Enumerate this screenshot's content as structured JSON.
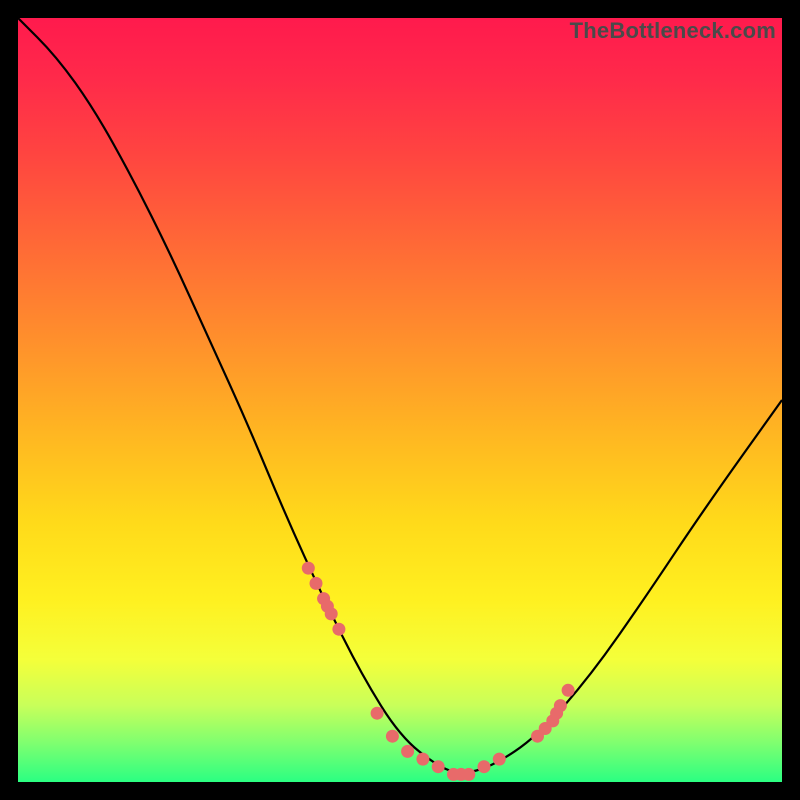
{
  "watermark": "TheBottleneck.com",
  "colors": {
    "frame": "#000000",
    "curve": "#000000",
    "dots": "#e86a6a",
    "gradient_top": "#ff1a4d",
    "gradient_bottom": "#2bff82"
  },
  "chart_data": {
    "type": "line",
    "title": "",
    "xlabel": "",
    "ylabel": "",
    "xlim": [
      0,
      100
    ],
    "ylim": [
      0,
      100
    ],
    "grid": false,
    "legend": false,
    "description": "V-shaped bottleneck curve; y decreases from ~100 at x=0 to ~0 near x≈55, then rises to ~50 at x=100. Salmon dots cluster on the curve between x≈38–72.",
    "series": [
      {
        "name": "curve",
        "x": [
          0,
          5,
          10,
          15,
          20,
          25,
          30,
          35,
          40,
          45,
          50,
          55,
          58,
          62,
          68,
          75,
          82,
          90,
          100
        ],
        "y": [
          100,
          95,
          88,
          79,
          69,
          58,
          47,
          35,
          24,
          14,
          6,
          2,
          1,
          2,
          6,
          14,
          24,
          36,
          50
        ]
      },
      {
        "name": "dots",
        "x": [
          38,
          39,
          40,
          40.5,
          41,
          42,
          47,
          49,
          51,
          53,
          55,
          57,
          58,
          59,
          61,
          63,
          68,
          69,
          70,
          70.5,
          71,
          72
        ],
        "y": [
          28,
          26,
          24,
          23,
          22,
          20,
          9,
          6,
          4,
          3,
          2,
          1,
          1,
          1,
          2,
          3,
          6,
          7,
          8,
          9,
          10,
          12
        ]
      }
    ]
  }
}
